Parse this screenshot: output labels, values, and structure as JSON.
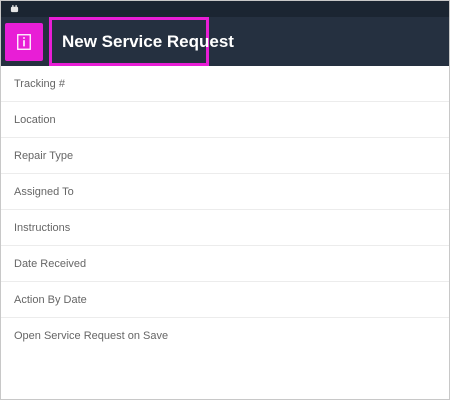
{
  "app_bar": {
    "title": "New Service Request",
    "info_icon": "info-icon"
  },
  "status_bar": {
    "icon": "android-icon"
  },
  "form": {
    "fields": [
      {
        "label": "Tracking #"
      },
      {
        "label": "Location"
      },
      {
        "label": "Repair Type"
      },
      {
        "label": "Assigned To"
      },
      {
        "label": "Instructions"
      },
      {
        "label": "Date Received"
      },
      {
        "label": "Action By Date"
      },
      {
        "label": "Open Service Request on Save"
      }
    ]
  },
  "colors": {
    "app_bar": "#253040",
    "status_bar": "#1b2532",
    "highlight": "#e81ed6"
  }
}
